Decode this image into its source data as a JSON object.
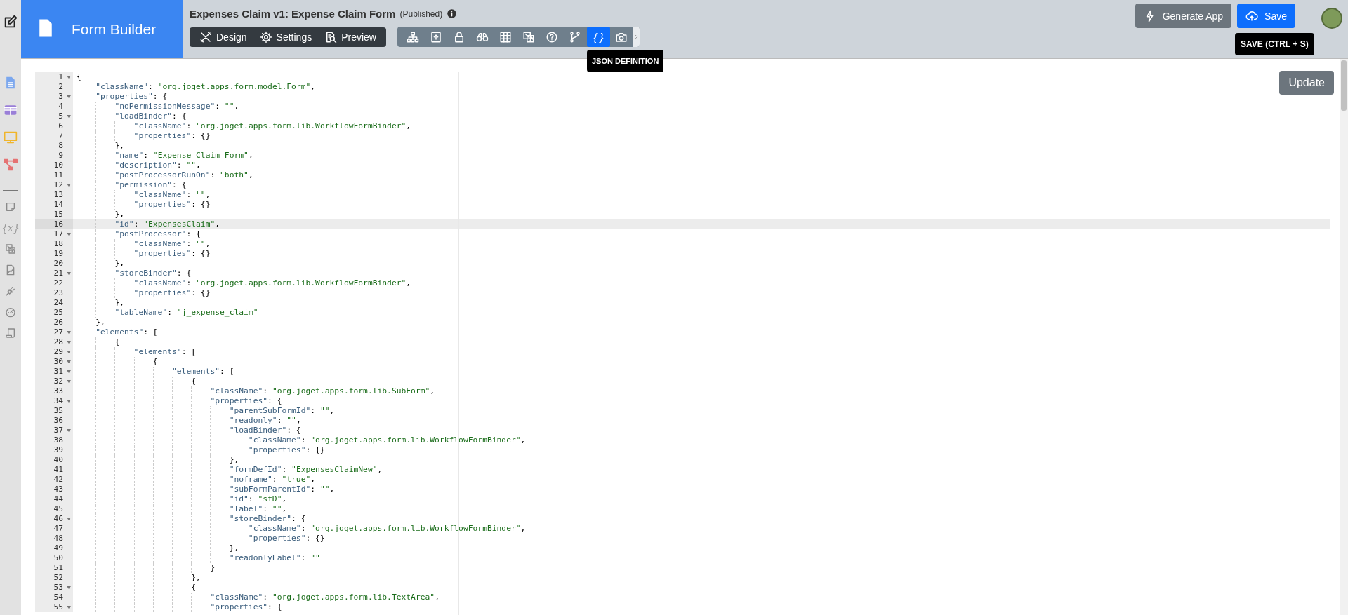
{
  "brand": {
    "title": "Form Builder"
  },
  "form": {
    "title": "Expenses Claim v1: Expense Claim Form",
    "status": "(Published)"
  },
  "modes": [
    {
      "label": "Design",
      "kind": "design"
    },
    {
      "label": "Settings",
      "kind": "gear"
    },
    {
      "label": "Preview",
      "kind": "preview"
    }
  ],
  "tools": [
    {
      "kind": "sitemap",
      "selected": false
    },
    {
      "kind": "form-upload",
      "selected": false
    },
    {
      "kind": "lock",
      "selected": false
    },
    {
      "kind": "binoculars",
      "selected": false
    },
    {
      "kind": "grid",
      "selected": false
    },
    {
      "kind": "translate",
      "selected": false
    },
    {
      "kind": "help",
      "selected": false
    },
    {
      "kind": "branch",
      "selected": false
    },
    {
      "kind": "braces",
      "label": "{ }",
      "tooltip": "JSON DEFINITION",
      "selected": true
    },
    {
      "kind": "camera",
      "selected": false
    }
  ],
  "actions": [
    {
      "label": "Generate App",
      "kind": "bolt"
    },
    {
      "label": "Save",
      "kind": "cloud",
      "tooltip": "SAVE (CTRL + S)"
    }
  ],
  "sidebar": {
    "items": [
      {
        "kind": "doc"
      },
      {
        "kind": "table"
      },
      {
        "kind": "monitor"
      },
      {
        "kind": "nodes"
      },
      {
        "kind": "separator"
      },
      {
        "kind": "note"
      },
      {
        "kind": "variable",
        "glyph": "{x}"
      },
      {
        "kind": "translate"
      },
      {
        "kind": "chart-doc"
      },
      {
        "kind": "plug"
      },
      {
        "kind": "gauge"
      },
      {
        "kind": "scroll"
      }
    ]
  },
  "editor": {
    "update_button": "Update",
    "lines": [
      {
        "n": "1",
        "code": "{",
        "foldable": true,
        "active": false
      },
      {
        "n": "2",
        "code": "    \"className\": \"org.joget.apps.form.model.Form\",",
        "foldable": false,
        "active": false
      },
      {
        "n": "3",
        "code": "    \"properties\": {",
        "foldable": true,
        "active": false
      },
      {
        "n": "4",
        "code": "        \"noPermissionMessage\": \"\",",
        "foldable": false,
        "active": false
      },
      {
        "n": "5",
        "code": "        \"loadBinder\": {",
        "foldable": true,
        "active": false
      },
      {
        "n": "6",
        "code": "            \"className\": \"org.joget.apps.form.lib.WorkflowFormBinder\",",
        "foldable": false,
        "active": false
      },
      {
        "n": "7",
        "code": "            \"properties\": {}",
        "foldable": false,
        "active": false
      },
      {
        "n": "8",
        "code": "        },",
        "foldable": false,
        "active": false
      },
      {
        "n": "9",
        "code": "        \"name\": \"Expense Claim Form\",",
        "foldable": false,
        "active": false
      },
      {
        "n": "10",
        "code": "        \"description\": \"\",",
        "foldable": false,
        "active": false
      },
      {
        "n": "11",
        "code": "        \"postProcessorRunOn\": \"both\",",
        "foldable": false,
        "active": false
      },
      {
        "n": "12",
        "code": "        \"permission\": {",
        "foldable": true,
        "active": false
      },
      {
        "n": "13",
        "code": "            \"className\": \"\",",
        "foldable": false,
        "active": false
      },
      {
        "n": "14",
        "code": "            \"properties\": {}",
        "foldable": false,
        "active": false
      },
      {
        "n": "15",
        "code": "        },",
        "foldable": false,
        "active": false
      },
      {
        "n": "16",
        "code": "        \"id\": \"ExpensesClaim\",",
        "foldable": false,
        "active": true
      },
      {
        "n": "17",
        "code": "        \"postProcessor\": {",
        "foldable": true,
        "active": false
      },
      {
        "n": "18",
        "code": "            \"className\": \"\",",
        "foldable": false,
        "active": false
      },
      {
        "n": "19",
        "code": "            \"properties\": {}",
        "foldable": false,
        "active": false
      },
      {
        "n": "20",
        "code": "        },",
        "foldable": false,
        "active": false
      },
      {
        "n": "21",
        "code": "        \"storeBinder\": {",
        "foldable": true,
        "active": false
      },
      {
        "n": "22",
        "code": "            \"className\": \"org.joget.apps.form.lib.WorkflowFormBinder\",",
        "foldable": false,
        "active": false
      },
      {
        "n": "23",
        "code": "            \"properties\": {}",
        "foldable": false,
        "active": false
      },
      {
        "n": "24",
        "code": "        },",
        "foldable": false,
        "active": false
      },
      {
        "n": "25",
        "code": "        \"tableName\": \"j_expense_claim\"",
        "foldable": false,
        "active": false
      },
      {
        "n": "26",
        "code": "    },",
        "foldable": false,
        "active": false
      },
      {
        "n": "27",
        "code": "    \"elements\": [",
        "foldable": true,
        "active": false
      },
      {
        "n": "28",
        "code": "        {",
        "foldable": true,
        "active": false
      },
      {
        "n": "29",
        "code": "            \"elements\": [",
        "foldable": true,
        "active": false
      },
      {
        "n": "30",
        "code": "                {",
        "foldable": true,
        "active": false
      },
      {
        "n": "31",
        "code": "                    \"elements\": [",
        "foldable": true,
        "active": false
      },
      {
        "n": "32",
        "code": "                        {",
        "foldable": true,
        "active": false
      },
      {
        "n": "33",
        "code": "                            \"className\": \"org.joget.apps.form.lib.SubForm\",",
        "foldable": false,
        "active": false
      },
      {
        "n": "34",
        "code": "                            \"properties\": {",
        "foldable": true,
        "active": false
      },
      {
        "n": "35",
        "code": "                                \"parentSubFormId\": \"\",",
        "foldable": false,
        "active": false
      },
      {
        "n": "36",
        "code": "                                \"readonly\": \"\",",
        "foldable": false,
        "active": false
      },
      {
        "n": "37",
        "code": "                                \"loadBinder\": {",
        "foldable": true,
        "active": false
      },
      {
        "n": "38",
        "code": "                                    \"className\": \"org.joget.apps.form.lib.WorkflowFormBinder\",",
        "foldable": false,
        "active": false
      },
      {
        "n": "39",
        "code": "                                    \"properties\": {}",
        "foldable": false,
        "active": false
      },
      {
        "n": "40",
        "code": "                                },",
        "foldable": false,
        "active": false
      },
      {
        "n": "41",
        "code": "                                \"formDefId\": \"ExpensesClaimNew\",",
        "foldable": false,
        "active": false
      },
      {
        "n": "42",
        "code": "                                \"noframe\": \"true\",",
        "foldable": false,
        "active": false
      },
      {
        "n": "43",
        "code": "                                \"subFormParentId\": \"\",",
        "foldable": false,
        "active": false
      },
      {
        "n": "44",
        "code": "                                \"id\": \"sfD\",",
        "foldable": false,
        "active": false
      },
      {
        "n": "45",
        "code": "                                \"label\": \"\",",
        "foldable": false,
        "active": false
      },
      {
        "n": "46",
        "code": "                                \"storeBinder\": {",
        "foldable": true,
        "active": false
      },
      {
        "n": "47",
        "code": "                                    \"className\": \"org.joget.apps.form.lib.WorkflowFormBinder\",",
        "foldable": false,
        "active": false
      },
      {
        "n": "48",
        "code": "                                    \"properties\": {}",
        "foldable": false,
        "active": false
      },
      {
        "n": "49",
        "code": "                                },",
        "foldable": false,
        "active": false
      },
      {
        "n": "50",
        "code": "                                \"readonlyLabel\": \"\"",
        "foldable": false,
        "active": false
      },
      {
        "n": "51",
        "code": "                            }",
        "foldable": false,
        "active": false
      },
      {
        "n": "52",
        "code": "                        },",
        "foldable": false,
        "active": false
      },
      {
        "n": "53",
        "code": "                        {",
        "foldable": true,
        "active": false
      },
      {
        "n": "54",
        "code": "                            \"className\": \"org.joget.apps.form.lib.TextArea\",",
        "foldable": false,
        "active": false
      },
      {
        "n": "55",
        "code": "                            \"properties\": {",
        "foldable": true,
        "active": false
      }
    ]
  }
}
